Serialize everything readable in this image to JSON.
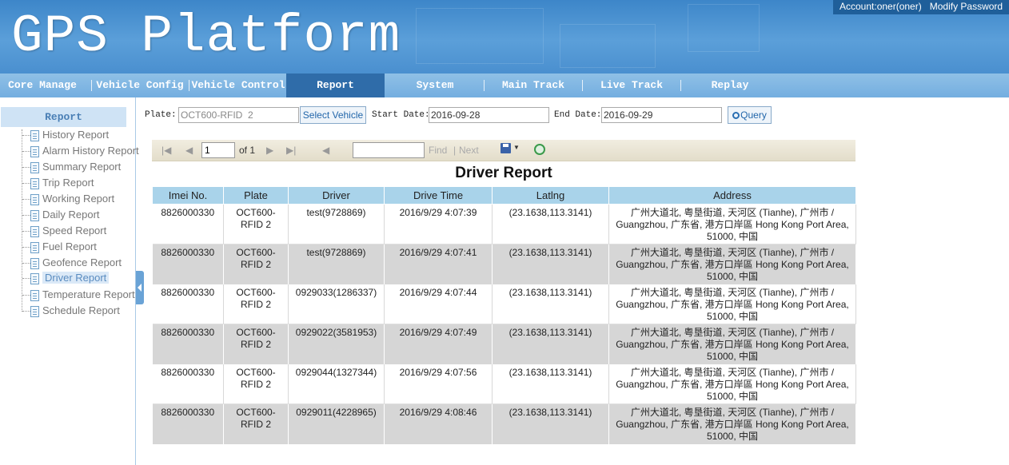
{
  "header": {
    "title": "GPS Platform",
    "account": "Account:oner(oner)",
    "modify_password": "Modify Password"
  },
  "nav": {
    "items": [
      "Core Manage",
      "Vehicle Config",
      "Vehicle Control",
      "Report",
      "System",
      "Main Track",
      "Live Track",
      "Replay"
    ],
    "active": "Report"
  },
  "sidebar": {
    "title": "Report",
    "items": [
      "History Report",
      "Alarm History Report",
      "Summary Report",
      "Trip Report",
      "Working Report",
      "Daily Report",
      "Speed Report",
      "Fuel Report",
      "Geofence Report",
      "Driver Report",
      "Temperature Report",
      "Schedule Report"
    ],
    "selected": "Driver Report"
  },
  "filters": {
    "plate_label": "Plate:",
    "plate_value": "OCT600-RFID  2",
    "select_vehicle": "Select Vehicle",
    "start_label": "Start Date:",
    "start_value": "2016-09-28",
    "end_label": "End Date:",
    "end_value": "2016-09-29",
    "query": "Query"
  },
  "toolbar": {
    "page": "1",
    "of": "of 1",
    "find": "Find",
    "separator": "|",
    "next": "Next"
  },
  "report": {
    "title": "Driver Report",
    "columns": [
      "Imei No.",
      "Plate",
      "Driver",
      "Drive Time",
      "Latlng",
      "Address"
    ],
    "rows": [
      {
        "imei": "8826000330",
        "plate": "OCT600-RFID  2",
        "driver": "test(9728869)",
        "time": "2016/9/29 4:07:39",
        "latlng": "(23.1638,113.3141)",
        "address": "广州大道北, 粤垦街道, 天河区 (Tianhe), 广州市 / Guangzhou, 广东省, 港方口岸區 Hong Kong Port Area, 51000, 中国"
      },
      {
        "imei": "8826000330",
        "plate": "OCT600-RFID  2",
        "driver": "test(9728869)",
        "time": "2016/9/29 4:07:41",
        "latlng": "(23.1638,113.3141)",
        "address": "广州大道北, 粤垦街道, 天河区 (Tianhe), 广州市 / Guangzhou, 广东省, 港方口岸區 Hong Kong Port Area, 51000, 中国"
      },
      {
        "imei": "8826000330",
        "plate": "OCT600-RFID  2",
        "driver": "0929033(1286337)",
        "time": "2016/9/29 4:07:44",
        "latlng": "(23.1638,113.3141)",
        "address": "广州大道北, 粤垦街道, 天河区 (Tianhe), 广州市 / Guangzhou, 广东省, 港方口岸區 Hong Kong Port Area, 51000, 中国"
      },
      {
        "imei": "8826000330",
        "plate": "OCT600-RFID  2",
        "driver": "0929022(3581953)",
        "time": "2016/9/29 4:07:49",
        "latlng": "(23.1638,113.3141)",
        "address": "广州大道北, 粤垦街道, 天河区 (Tianhe), 广州市 / Guangzhou, 广东省, 港方口岸區 Hong Kong Port Area, 51000, 中国"
      },
      {
        "imei": "8826000330",
        "plate": "OCT600-RFID  2",
        "driver": "0929044(1327344)",
        "time": "2016/9/29 4:07:56",
        "latlng": "(23.1638,113.3141)",
        "address": "广州大道北, 粤垦街道, 天河区 (Tianhe), 广州市 / Guangzhou, 广东省, 港方口岸區 Hong Kong Port Area, 51000, 中国"
      },
      {
        "imei": "8826000330",
        "plate": "OCT600-RFID  2",
        "driver": "0929011(4228965)",
        "time": "2016/9/29 4:08:46",
        "latlng": "(23.1638,113.3141)",
        "address": "广州大道北, 粤垦街道, 天河区 (Tianhe), 广州市 / Guangzhou, 广东省, 港方口岸區 Hong Kong Port Area, 51000, 中国"
      }
    ]
  }
}
